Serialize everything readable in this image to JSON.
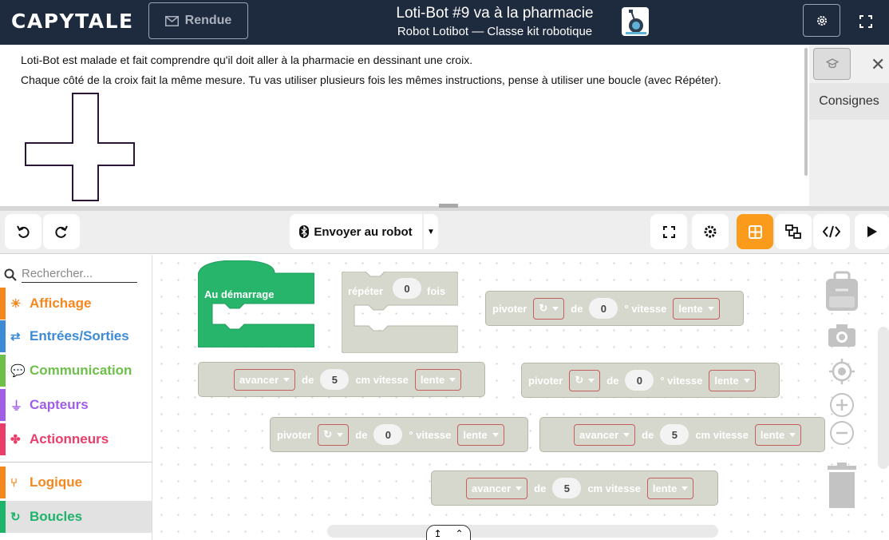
{
  "app": {
    "logo": "CAPYTALE",
    "rendue_label": "Rendue"
  },
  "activity": {
    "title": "Loti-Bot #9 va à la pharmacie",
    "subtitle": "Robot Lotibot — Classe kit robotique"
  },
  "instructions": {
    "line1": "Loti-Bot est malade et fait comprendre qu'il doit aller à la pharmacie en dessinant une croix.",
    "line2": "Chaque côté de la croix fait la même mesure. Tu vas utiliser plusieurs fois les mêmes instructions, pense à utiliser une boucle (avec Répéter)."
  },
  "side_panel": {
    "tab_label": "Consignes"
  },
  "toolbar": {
    "send_label": "Envoyer au robot"
  },
  "palette": {
    "search_placeholder": "Rechercher...",
    "categories": [
      {
        "label": "Affichage",
        "color": "#f5871f",
        "icon": "lightbulb-icon"
      },
      {
        "label": "Entrées/Sorties",
        "color": "#3d8ad6",
        "icon": "arrows-icon"
      },
      {
        "label": "Communication",
        "color": "#6cc04a",
        "icon": "chat-icon"
      },
      {
        "label": "Capteurs",
        "color": "#a05ee6",
        "icon": "plug-icon"
      },
      {
        "label": "Actionneurs",
        "color": "#ea3d6a",
        "icon": "fan-icon"
      },
      {
        "label": "Logique",
        "color": "#f5871f",
        "icon": "branch-icon"
      },
      {
        "label": "Boucles",
        "color": "#1eb36b",
        "icon": "loop-icon"
      }
    ]
  },
  "blocks": {
    "start_label": "Au démarrage",
    "repeat": {
      "label": "répéter",
      "count": "0",
      "suffix": "fois"
    },
    "words": {
      "pivoter": "pivoter",
      "avancer": "avancer",
      "de": "de",
      "deg": "° vitesse",
      "cm": "cm vitesse",
      "lente": "lente"
    },
    "numbers": {
      "zero": "0",
      "five": "5"
    },
    "dir_glyph": "↻"
  },
  "colors": {
    "topbar": "#1e2a3e",
    "accent": "#fb9b1b",
    "start_block": "#27b46b",
    "disabled_block": "#d6d8cd",
    "dropdown_border": "#c55f5f"
  }
}
